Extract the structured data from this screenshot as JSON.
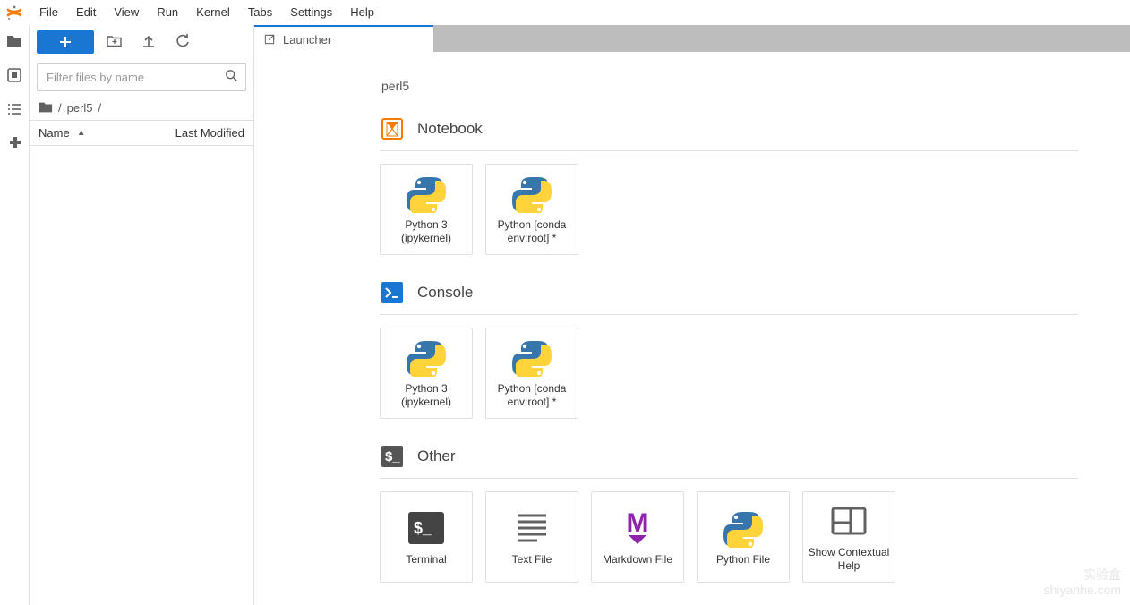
{
  "menu": [
    "File",
    "Edit",
    "View",
    "Run",
    "Kernel",
    "Tabs",
    "Settings",
    "Help"
  ],
  "filebrowser": {
    "search_placeholder": "Filter files by name",
    "breadcrumb_parts": [
      "/",
      "perl5",
      "/"
    ],
    "columns": {
      "name": "Name",
      "modified": "Last Modified"
    }
  },
  "tab": {
    "title": "Launcher"
  },
  "launcher": {
    "cwd": "perl5",
    "sections": [
      {
        "id": "notebook",
        "title": "Notebook",
        "icon": "notebook",
        "cards": [
          {
            "label": "Python 3 (ipykernel)",
            "icon": "python"
          },
          {
            "label": "Python [conda env:root] *",
            "icon": "python"
          }
        ]
      },
      {
        "id": "console",
        "title": "Console",
        "icon": "console",
        "cards": [
          {
            "label": "Python 3 (ipykernel)",
            "icon": "python"
          },
          {
            "label": "Python [conda env:root] *",
            "icon": "python"
          }
        ]
      },
      {
        "id": "other",
        "title": "Other",
        "icon": "other",
        "cards": [
          {
            "label": "Terminal",
            "icon": "terminal"
          },
          {
            "label": "Text File",
            "icon": "textfile"
          },
          {
            "label": "Markdown File",
            "icon": "markdown"
          },
          {
            "label": "Python File",
            "icon": "python"
          },
          {
            "label": "Show Contextual Help",
            "icon": "help"
          }
        ]
      }
    ]
  },
  "watermark": {
    "line1": "实验盒",
    "line2": "shiyanhe.com"
  }
}
